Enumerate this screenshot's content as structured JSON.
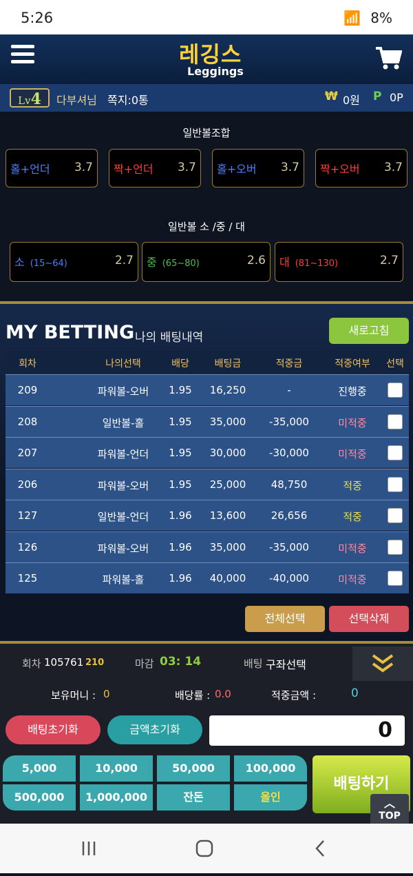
{
  "status_bar": {
    "time": "5:26",
    "battery": "8%"
  },
  "header": {
    "logo_text": "레깅스",
    "logo_sub": "Leggings"
  },
  "user": {
    "level_prefix": "Lv",
    "level": "4",
    "name": "다부셔님",
    "messages": "쪽지:0통",
    "won_symbol": "₩",
    "won_value": "0원",
    "point_symbol": "P",
    "point_value": "0P"
  },
  "combo_section": {
    "title": "일반볼조합",
    "items": [
      {
        "label": "홀+언더",
        "odds": "3.7",
        "color": "#4a7dff"
      },
      {
        "label": "짝+언더",
        "odds": "3.7",
        "color": "#ff3b3b"
      },
      {
        "label": "홀+오버",
        "odds": "3.7",
        "color": "#4a7dff"
      },
      {
        "label": "짝+오버",
        "odds": "3.7",
        "color": "#ff3b3b"
      }
    ]
  },
  "size_section": {
    "title": "일반볼 소 /중 / 대",
    "items": [
      {
        "label": "소",
        "range": "(15~64)",
        "odds": "2.7",
        "color": "#4a7dff"
      },
      {
        "label": "중",
        "range": "(65~80)",
        "odds": "2.6",
        "color": "#4fbf4f"
      },
      {
        "label": "대",
        "range": "(81~130)",
        "odds": "2.7",
        "color": "#ff3b3b"
      }
    ]
  },
  "my_betting": {
    "title": "MY BETTING",
    "subtitle": "나의 배팅내역",
    "refresh_label": "새로고침",
    "columns": [
      "회차",
      "나의선택",
      "배당",
      "배팅금",
      "적중금",
      "적중여부",
      "선택"
    ],
    "rows": [
      {
        "round": "209",
        "choice": "파워볼-오버",
        "odds": "1.95",
        "amount": "16,250",
        "payout": "-",
        "result": "진행중",
        "status": "prog"
      },
      {
        "round": "208",
        "choice": "일반볼-홀",
        "odds": "1.95",
        "amount": "35,000",
        "payout": "-35,000",
        "result": "미적중",
        "status": "lose"
      },
      {
        "round": "207",
        "choice": "파워볼-언더",
        "odds": "1.95",
        "amount": "30,000",
        "payout": "-30,000",
        "result": "미적중",
        "status": "lose"
      },
      {
        "round": "206",
        "choice": "파워볼-오버",
        "odds": "1.95",
        "amount": "25,000",
        "payout": "48,750",
        "result": "적중",
        "status": "win"
      },
      {
        "round": "127",
        "choice": "일반볼-언더",
        "odds": "1.96",
        "amount": "13,600",
        "payout": "26,656",
        "result": "적중",
        "status": "win"
      },
      {
        "round": "126",
        "choice": "파워볼-오버",
        "odds": "1.96",
        "amount": "35,000",
        "payout": "-35,000",
        "result": "미적중",
        "status": "lose"
      },
      {
        "round": "125",
        "choice": "파워볼-홀",
        "odds": "1.96",
        "amount": "40,000",
        "payout": "-40,000",
        "result": "미적중",
        "status": "lose"
      }
    ],
    "select_all_label": "전체선택",
    "delete_label": "선택삭제"
  },
  "bet_panel": {
    "round_label": "회차",
    "round_value": "105761",
    "round_sub": "210",
    "deadline_label": "마감",
    "deadline_value": "03: 14",
    "betting_label": "배팅",
    "betting_value": "구좌선택",
    "money_label": "보유머니 :",
    "money_value": "0",
    "odds_label": "배당률 :",
    "odds_value": "0.0",
    "win_label": "적중금액 :",
    "win_value": "0",
    "reset_bet_label": "배팅초기화",
    "reset_amount_label": "금액초기화",
    "amount_value": "0",
    "chips": [
      "5,000",
      "10,000",
      "50,000",
      "100,000",
      "500,000",
      "1,000,000",
      "잔돈",
      "올인"
    ],
    "bet_button": "배팅하기",
    "top_label": "TOP"
  }
}
